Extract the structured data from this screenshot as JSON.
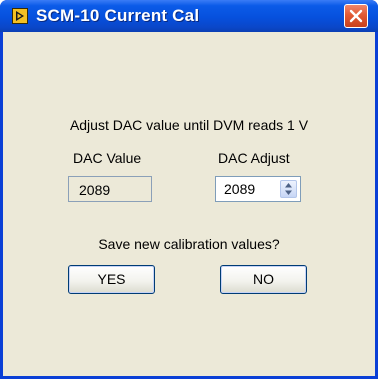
{
  "window": {
    "title": "SCM-10 Current Cal",
    "icon": "labview-icon",
    "close_icon": "close-icon"
  },
  "instruction": "Adjust DAC value until DVM reads 1 V",
  "dac_value": {
    "label": "DAC Value",
    "value": "2089"
  },
  "dac_adjust": {
    "label": "DAC Adjust",
    "value": "2089",
    "spinner_icon": "up-down-spinner-icon"
  },
  "prompt": "Save new calibration values?",
  "buttons": {
    "yes_label": "YES",
    "no_label": "NO"
  },
  "colors": {
    "titlebar": "#0650dd",
    "dialog_background": "#ece9d8",
    "close_button": "#e25a34"
  }
}
